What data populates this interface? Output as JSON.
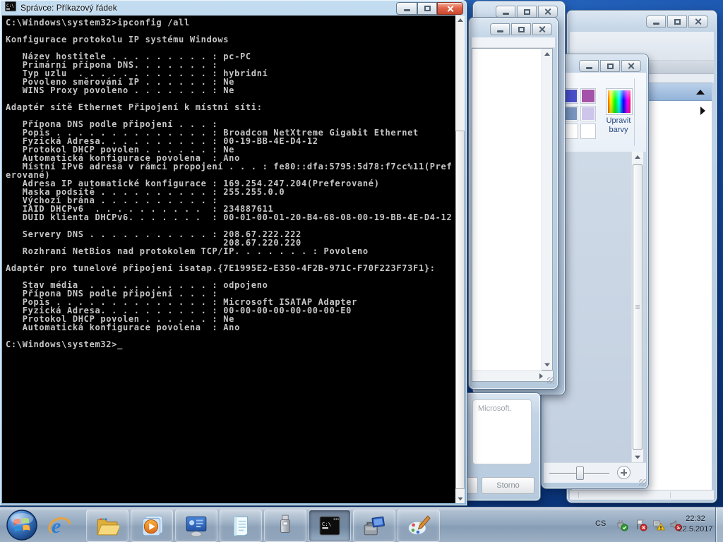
{
  "window_cmd": {
    "title": "Správce: Příkazový řádek",
    "console_lines": [
      "C:\\Windows\\system32>ipconfig /all",
      "",
      "Konfigurace protokolu IP systému Windows",
      "",
      "   Název hostitele . . . . . . . . . : pc-PC",
      "   Primární přípona DNS. . . . . . . :",
      "   Typ uzlu  . . . . . . . . . . . . : hybridní",
      "   Povoleno směrování IP . . . . . . : Ne",
      "   WINS Proxy povoleno . . . . . . . : Ne",
      "",
      "Adaptér sítě Ethernet Připojení k místní síti:",
      "",
      "   Přípona DNS podle připojení . . . :",
      "   Popis . . . . . . . . . . . . . . : Broadcom NetXtreme Gigabit Ethernet",
      "   Fyzická Adresa. . . . . . . . . . : 00-19-BB-4E-D4-12",
      "   Protokol DHCP povolen . . . . . . : Ne",
      "   Automatická konfigurace povolena  : Ano",
      "   Místní IPv6 adresa v rámci propojení . . . : fe80::dfa:5795:5d78:f7cc%11(Pref",
      "erované)",
      "   Adresa IP automatické konfigurace : 169.254.247.204(Preferované)",
      "   Maska podsítě . . . . . . . . . . : 255.255.0.0",
      "   Výchozí brána . . . . . . . . . . :",
      "   IAID DHCPv6  . . . . . . . . . .  : 234887611",
      "   DUID klienta DHCPv6. . . . . . .  : 00-01-00-01-20-B4-68-08-00-19-BB-4E-D4-12",
      "",
      "   Servery DNS . . . . . . . . . . . : 208.67.222.222",
      "                                       208.67.220.220",
      "   Rozhraní NetBios nad protokolem TCP/IP. . . . . . . : Povoleno",
      "",
      "Adaptér pro tunelové připojení isatap.{7E1995E2-E350-4F2B-971C-F70F223F73F1}:",
      "",
      "   Stav média  . . . . . . . . . . . : odpojeno",
      "   Přípona DNS podle připojení . . . :",
      "   Popis . . . . . . . . . . . . . . : Microsoft ISATAP Adapter",
      "   Fyzická Adresa. . . . . . . . . . : 00-00-00-00-00-00-00-E0",
      "   Protokol DHCP povolen . . . . . . : Ne",
      "   Automatická konfigurace povolena  : Ano",
      "",
      "C:\\Windows\\system32>_"
    ],
    "text_color": "#c6c6c6",
    "background_color": "#000000"
  },
  "paint_window": {
    "edit_colors_line1": "Upravit",
    "edit_colors_line2": "barvy",
    "swatches": [
      "#00b0d8",
      "#4a50cc",
      "#a552aa",
      "#a6e6f2",
      "#7a96bf",
      "#cec6ea",
      "#ffffff",
      "#ffffff",
      "#ffffff"
    ]
  },
  "dialog": {
    "body_text": "Microsoft.",
    "cancel_label": "Storno"
  },
  "taskbar": {
    "items": [
      "start",
      "internet-explorer",
      "windows-explorer",
      "media-player",
      "control-panel",
      "notepad",
      "usb-device",
      "command-prompt",
      "computer",
      "paint"
    ],
    "active_item": "command-prompt",
    "tray": {
      "language": "CS",
      "time": "22:32",
      "date": "22.5.2017",
      "icons": [
        "usb-safely-remove-ok",
        "action-center-error-flag",
        "network-warning",
        "volume-muted"
      ]
    }
  }
}
